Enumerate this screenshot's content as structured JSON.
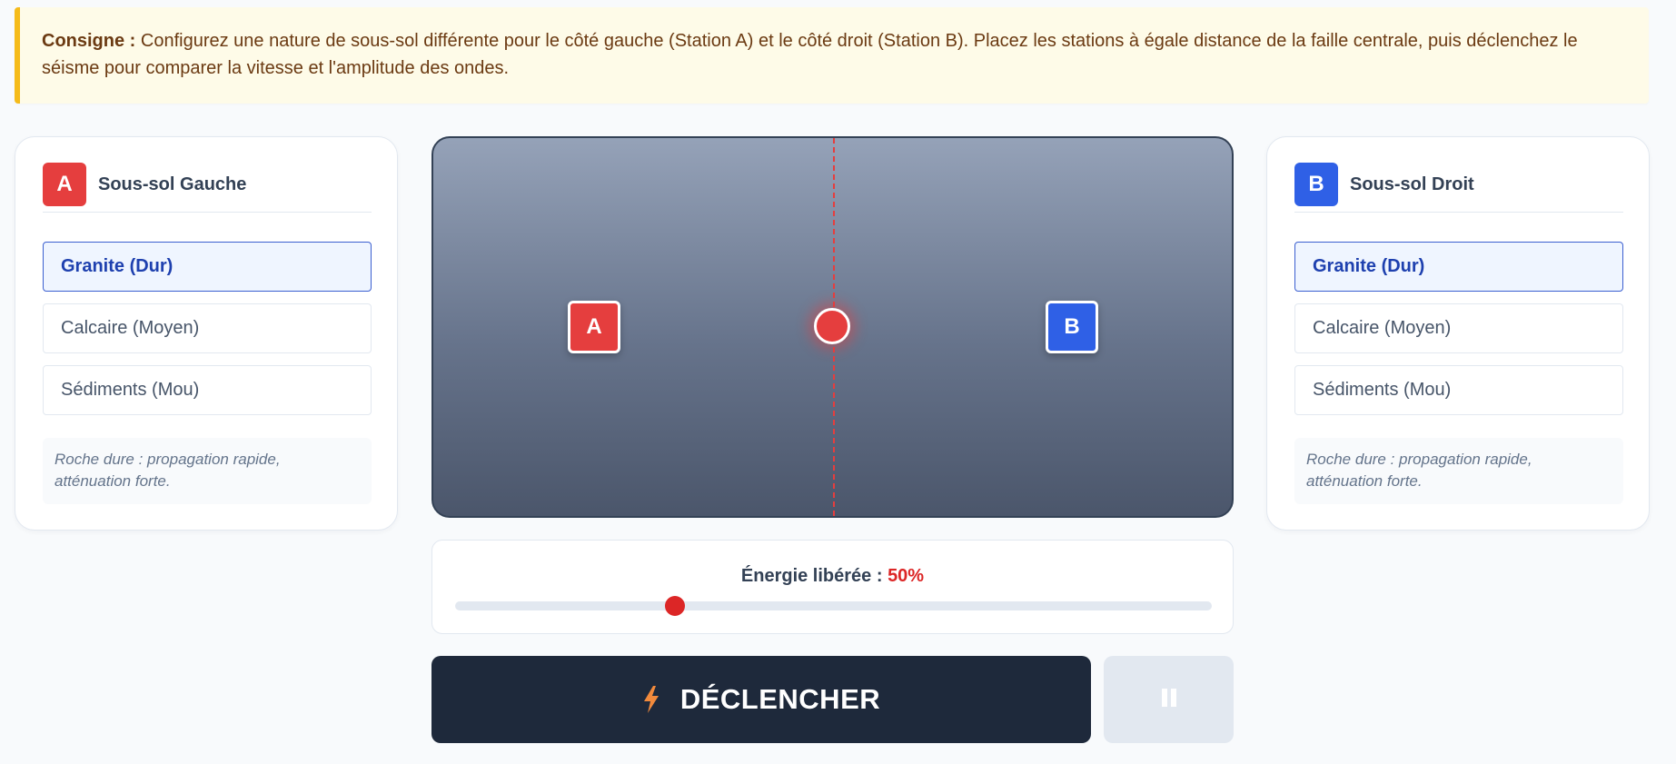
{
  "instruction": {
    "label": "Consigne :",
    "text": "Configurez une nature de sous-sol différente pour le côté gauche (Station A) et le côté droit (Station B). Placez les stations à égale distance de la faille centrale, puis déclenchez le séisme pour comparer la vitesse et l'amplitude des ondes."
  },
  "left_panel": {
    "badge": "A",
    "title": "Sous-sol Gauche",
    "options": [
      "Granite (Dur)",
      "Calcaire (Moyen)",
      "Sédiments (Mou)"
    ],
    "selected": "Granite (Dur)",
    "hint": "Roche dure : propagation rapide, atténuation forte."
  },
  "right_panel": {
    "badge": "B",
    "title": "Sous-sol Droit",
    "options": [
      "Granite (Dur)",
      "Calcaire (Moyen)",
      "Sédiments (Mou)"
    ],
    "selected": "Granite (Dur)",
    "hint": "Roche dure : propagation rapide, atténuation forte."
  },
  "scene": {
    "station_a": "A",
    "station_b": "B"
  },
  "energy": {
    "label": "Énergie libérée : ",
    "value_text": "50%",
    "slider_fraction": 0.29
  },
  "controls": {
    "trigger_label": "DÉCLENCHER",
    "trigger_icon": "lightning-icon",
    "pause_icon": "pause-icon"
  },
  "colors": {
    "station_a": "#e53e3e",
    "station_b": "#2f60e6",
    "accent_energy": "#dc2626",
    "notice_border": "#f5bb1a"
  }
}
